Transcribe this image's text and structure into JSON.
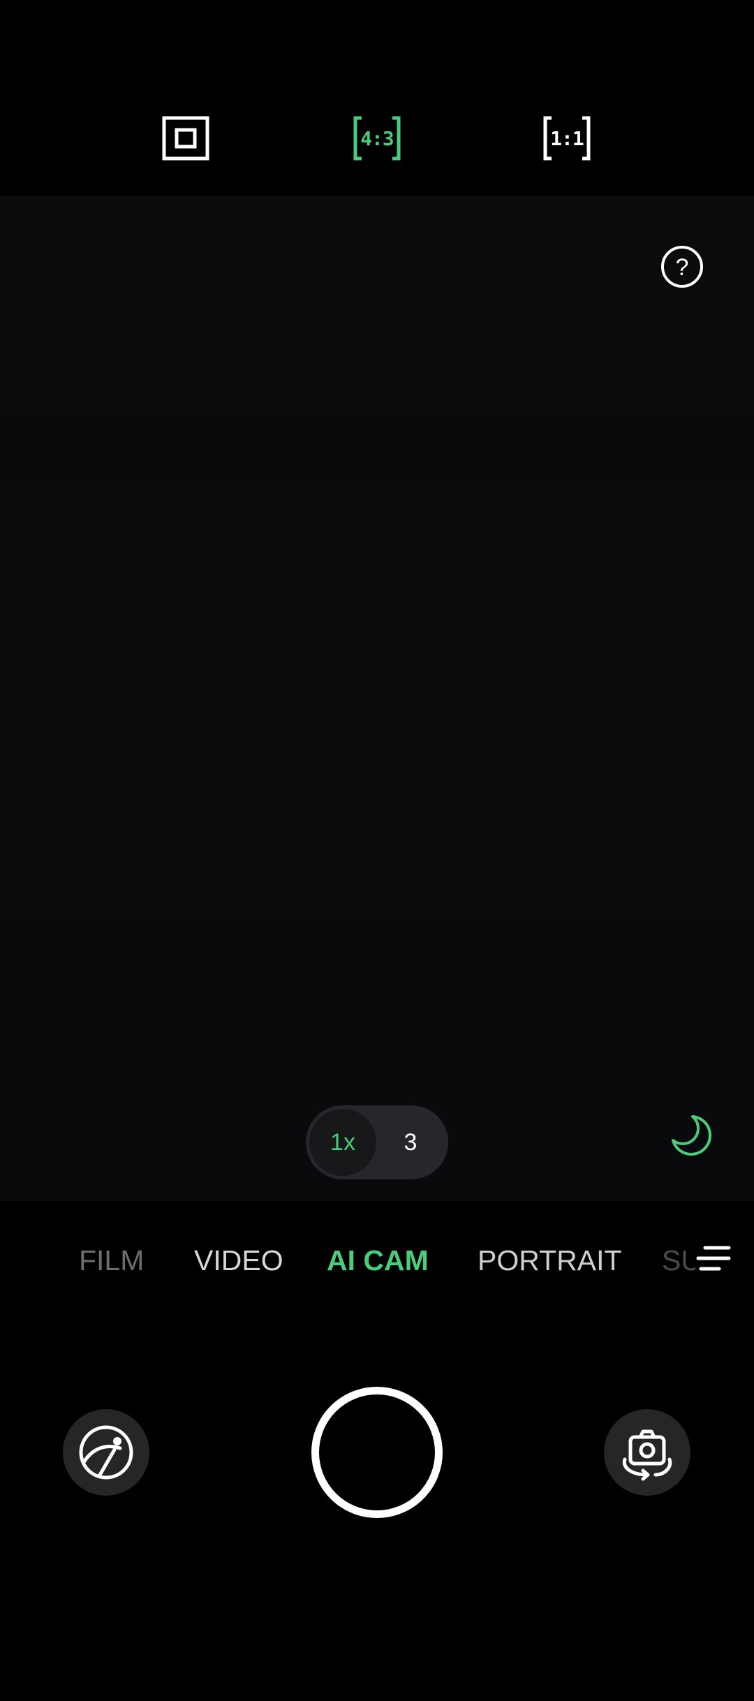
{
  "aspect_ratios": [
    {
      "id": "full",
      "label": "",
      "icon": "full-frame-icon",
      "active": false
    },
    {
      "id": "4:3",
      "label": "4:3",
      "icon": "ratio-4-3-icon",
      "active": true
    },
    {
      "id": "1:1",
      "label": "1:1",
      "icon": "ratio-1-1-icon",
      "active": false
    }
  ],
  "help": {
    "label": "?",
    "icon": "help-icon"
  },
  "night_mode": {
    "icon": "moon-icon",
    "active": true
  },
  "zoom": {
    "options": [
      "1x",
      "3"
    ],
    "selected": "1x"
  },
  "modes": {
    "film": "FILM",
    "video": "VIDEO",
    "ai_cam": "AI CAM",
    "portrait": "PORTRAIT",
    "super": "SU",
    "selected": "AI CAM"
  },
  "controls": {
    "gallery_icon": "gallery-icon",
    "shutter_icon": "shutter-button",
    "flip_icon": "flip-camera-icon",
    "more_icon": "more-modes-icon"
  },
  "colors": {
    "accent": "#4ccb7c",
    "background": "#000000",
    "viewfinder": "#0a0b0d",
    "text_primary": "#d6d6d6",
    "text_muted": "#6e6e6e",
    "button_bg": "#262626"
  }
}
